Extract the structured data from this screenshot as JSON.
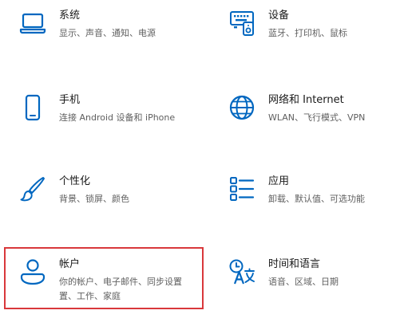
{
  "accent_color": "#0067c0",
  "highlight_color": "#d9383b",
  "settings": [
    {
      "id": "system",
      "icon": "laptop-icon",
      "title": "系统",
      "desc": [
        "显示、声音、通知、电源"
      ]
    },
    {
      "id": "devices",
      "icon": "keyboard-speaker-icon",
      "title": "设备",
      "desc": [
        "蓝牙、打印机、鼠标"
      ]
    },
    {
      "id": "phone",
      "icon": "phone-icon",
      "title": "手机",
      "desc": [
        "连接 Android 设备和 iPhone"
      ]
    },
    {
      "id": "network",
      "icon": "globe-icon",
      "title": "网络和 Internet",
      "desc": [
        "WLAN、飞行模式、VPN"
      ]
    },
    {
      "id": "personalization",
      "icon": "paintbrush-icon",
      "title": "个性化",
      "desc": [
        "背景、锁屏、颜色"
      ]
    },
    {
      "id": "apps",
      "icon": "apps-list-icon",
      "title": "应用",
      "desc": [
        "卸载、默认值、可选功能"
      ]
    },
    {
      "id": "accounts",
      "icon": "person-icon",
      "title": "帐户",
      "desc": [
        "你的帐户、电子邮件、同步设置",
        "置、工作、家庭"
      ]
    },
    {
      "id": "time-language",
      "icon": "time-language-icon",
      "title": "时间和语言",
      "desc": [
        "语音、区域、日期"
      ]
    }
  ]
}
